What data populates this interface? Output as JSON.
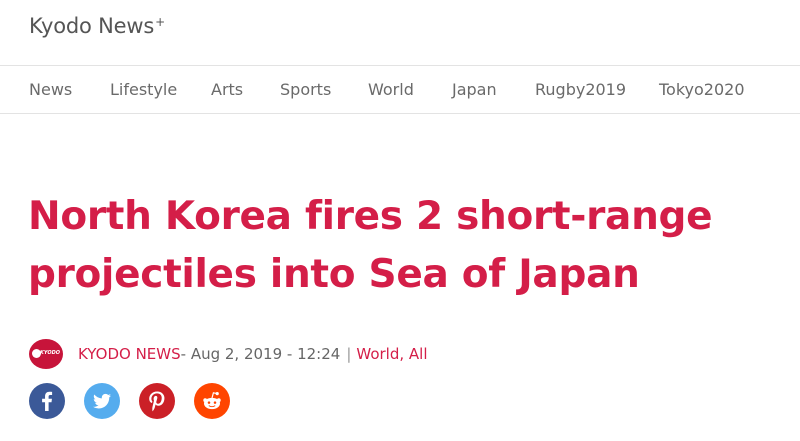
{
  "site": {
    "name": "Kyodo News",
    "name_sup": "+"
  },
  "nav": {
    "items": [
      "News",
      "Lifestyle",
      "Arts",
      "Sports",
      "World",
      "Japan",
      "Rugby2019",
      "Tokyo2020"
    ]
  },
  "article": {
    "headline_lines": [
      "North Korea fires 2 short-range",
      "projectiles into Sea of Japan"
    ],
    "author": "KYODO NEWS",
    "date_text": " - Aug 2, 2019 - 12:24",
    "separator": "|",
    "categories": "World, All",
    "avatar_text": "KYODO"
  },
  "share": {
    "buttons": [
      "facebook-icon",
      "twitter-icon",
      "pinterest-icon",
      "reddit-icon"
    ]
  },
  "colors": {
    "accent": "#d41e48",
    "facebook": "#3b5998",
    "twitter": "#55acee",
    "pinterest": "#cb2027",
    "reddit": "#ff4500"
  }
}
